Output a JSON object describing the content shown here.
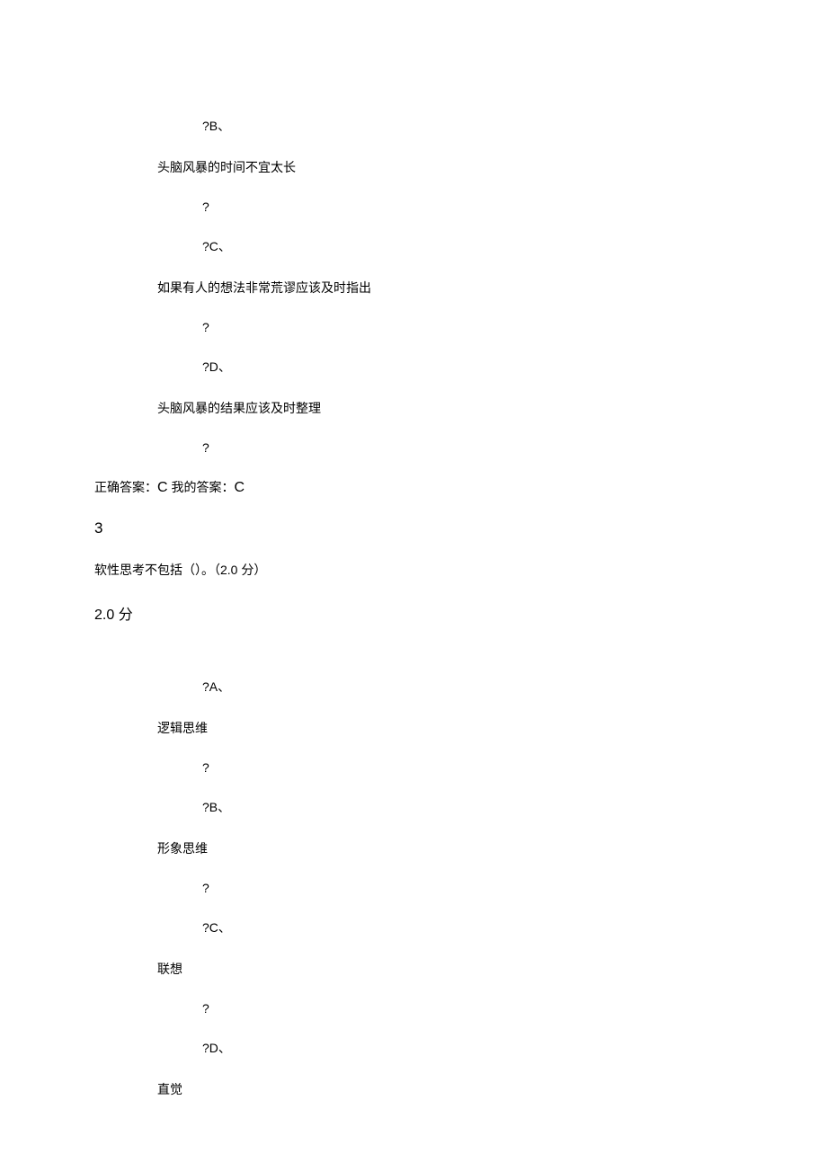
{
  "q2": {
    "options": {
      "b": {
        "label": "?B、",
        "text": "头脑风暴的时间不宜太长"
      },
      "c": {
        "label": "?C、",
        "text": "如果有人的想法非常荒谬应该及时指出"
      },
      "d": {
        "label": "?D、",
        "text": "头脑风暴的结果应该及时整理"
      }
    },
    "qmark": "?",
    "answer_prefix": "正确答案：",
    "correct": "C",
    "my_prefix": " 我的答案：",
    "my_answer": "C"
  },
  "q3": {
    "number": "3",
    "question": "软性思考不包括（）。（2.0 分）",
    "points": "2.0 分",
    "options": {
      "a": {
        "label": "?A、",
        "text": "逻辑思维"
      },
      "b": {
        "label": "?B、",
        "text": "形象思维"
      },
      "c": {
        "label": "?C、",
        "text": "联想"
      },
      "d": {
        "label": "?D、",
        "text": "直觉"
      }
    },
    "qmark": "?"
  }
}
